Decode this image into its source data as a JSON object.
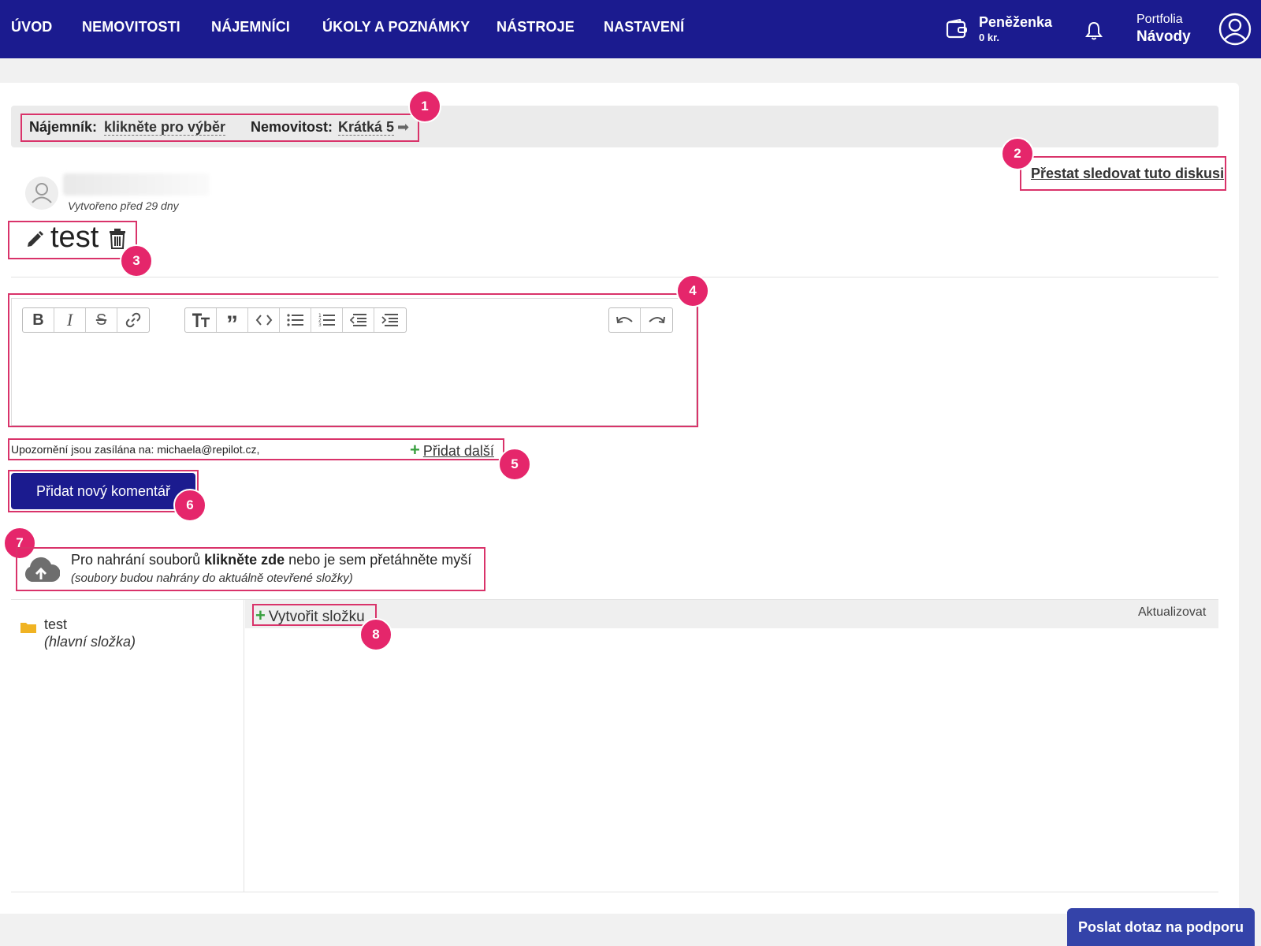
{
  "nav": {
    "items": [
      {
        "label": "ÚVOD"
      },
      {
        "label": "NEMOVITOSTI"
      },
      {
        "label": "NÁJEMNÍCI"
      },
      {
        "label": "ÚKOLY A POZNÁMKY"
      },
      {
        "label": "NÁSTROJE"
      },
      {
        "label": "NASTAVENÍ"
      }
    ],
    "wallet": {
      "title": "Peněženka",
      "amount": "0 kr."
    },
    "portfolio": {
      "label": "Portfolia",
      "value": "Návody"
    }
  },
  "filter": {
    "tenant_label": "Nájemník:",
    "tenant_value": "klikněte pro výběr",
    "property_label": "Nemovitost:",
    "property_value": "Krátká 5"
  },
  "discussion": {
    "unfollow_label": "Přestat sledovat tuto diskusi",
    "created": "Vytvořeno před 29 dny",
    "title": "test"
  },
  "notify": {
    "text": "Upozornění jsou zasílána na: michaela@repilot.cz,",
    "add_more": "Přidat další"
  },
  "comment_button": "Přidat nový komentář",
  "upload": {
    "line1_pre": "Pro nahrání souborů ",
    "line1_bold": "klikněte zde",
    "line1_post": " nebo je sem přetáhněte myší",
    "line2": "(soubory budou nahrány do aktuálně otevřené složky)"
  },
  "files": {
    "folder_name": "test",
    "folder_sub": "(hlavní složka)",
    "create_folder": "Vytvořit složku",
    "refresh": "Aktualizovat"
  },
  "annotations": [
    "1",
    "2",
    "3",
    "4",
    "5",
    "6",
    "7",
    "8"
  ],
  "support_button": "Poslat dotaz na podporu",
  "colors": {
    "nav_bg": "#1b1b8f",
    "highlight": "#d9336a",
    "badge": "#e5266b",
    "primary_button": "#1b1b8f",
    "support_button": "#3443a9",
    "plus_green": "#3aa040"
  }
}
